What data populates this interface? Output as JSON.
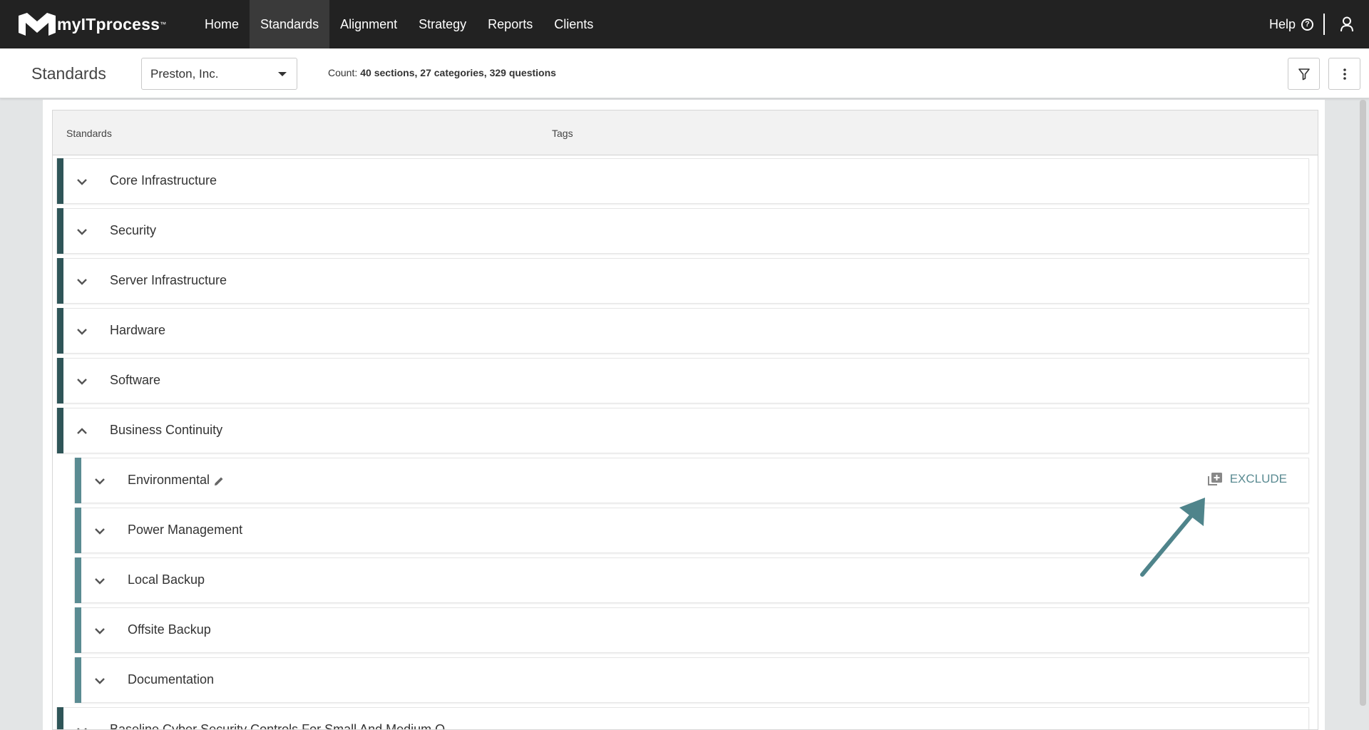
{
  "nav": {
    "logo_text": "myITprocess",
    "logo_tm": "™",
    "items": [
      "Home",
      "Standards",
      "Alignment",
      "Strategy",
      "Reports",
      "Clients"
    ],
    "active": "Standards",
    "help": "Help"
  },
  "subheader": {
    "title": "Standards",
    "client": "Preston, Inc.",
    "count_label": "Count:",
    "count_value": "40 sections, 27 categories, 329 questions"
  },
  "table": {
    "col_standards": "Standards",
    "col_tags": "Tags"
  },
  "rows": [
    {
      "label": "Core Infrastructure",
      "level": "section",
      "expanded": false
    },
    {
      "label": "Security",
      "level": "section",
      "expanded": false
    },
    {
      "label": "Server Infrastructure",
      "level": "section",
      "expanded": false
    },
    {
      "label": "Hardware",
      "level": "section",
      "expanded": false
    },
    {
      "label": "Software",
      "level": "section",
      "expanded": false
    },
    {
      "label": "Business Continuity",
      "level": "section",
      "expanded": true
    },
    {
      "label": "Environmental",
      "level": "category",
      "expanded": false,
      "editable": true,
      "action": "EXCLUDE"
    },
    {
      "label": "Power Management",
      "level": "category",
      "expanded": false
    },
    {
      "label": "Local Backup",
      "level": "category",
      "expanded": false
    },
    {
      "label": "Offsite Backup",
      "level": "category",
      "expanded": false
    },
    {
      "label": "Documentation",
      "level": "category",
      "expanded": false
    },
    {
      "label": "Baseline Cyber Security Controls For Small And Medium O...",
      "level": "section",
      "expanded": false
    }
  ],
  "colors": {
    "nav_bg": "#222222",
    "section_bar": "#2f5558",
    "category_bar": "#5a8b92",
    "arrow": "#4f848b"
  },
  "icons": {
    "filter": "filter-icon",
    "more": "more-vertical-icon",
    "user": "user-icon",
    "help": "help-circle-icon",
    "edit": "pencil-icon",
    "exclude": "add-box-icon"
  }
}
